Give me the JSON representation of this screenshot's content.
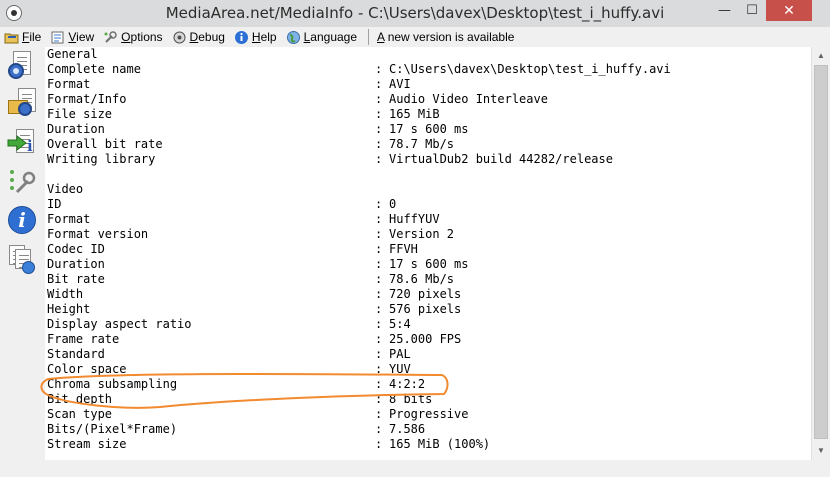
{
  "window": {
    "title": "MediaArea.net/MediaInfo - C:\\Users\\davex\\Desktop\\test_i_huffy.avi",
    "minimize_glyph": "—",
    "maximize_glyph": "☐",
    "close_glyph": "✕"
  },
  "menu": {
    "file": {
      "key": "F",
      "rest": "ile",
      "icon": "folder-icon"
    },
    "view": {
      "key": "V",
      "rest": "iew",
      "icon": "view-icon"
    },
    "options": {
      "key": "O",
      "rest": "ptions",
      "icon": "options-icon"
    },
    "debug": {
      "key": "D",
      "rest": "ebug",
      "icon": "debug-icon"
    },
    "help": {
      "key": "H",
      "rest": "elp",
      "icon": "help-icon"
    },
    "language": {
      "key": "L",
      "rest": "anguage",
      "icon": "globe-icon"
    },
    "update": {
      "key": "A",
      "rest": " new version is available"
    }
  },
  "toolbar": [
    "open-file-icon",
    "open-folder-icon",
    "export-icon",
    "preferences-icon",
    "about-icon",
    "knowledge-base-icon"
  ],
  "info": {
    "general": {
      "heading": "General",
      "complete_name": {
        "name": "Complete name",
        "value": "C:\\Users\\davex\\Desktop\\test_i_huffy.avi"
      },
      "format": {
        "name": "Format",
        "value": "AVI"
      },
      "format_info": {
        "name": "Format/Info",
        "value": "Audio Video Interleave"
      },
      "file_size": {
        "name": "File size",
        "value": "165 MiB"
      },
      "duration": {
        "name": "Duration",
        "value": "17 s 600 ms"
      },
      "overall_bit_rate": {
        "name": "Overall bit rate",
        "value": "78.7 Mb/s"
      },
      "writing_library": {
        "name": "Writing library",
        "value": "VirtualDub2 build 44282/release"
      }
    },
    "video": {
      "heading": "Video",
      "id": {
        "name": "ID",
        "value": "0"
      },
      "format": {
        "name": "Format",
        "value": "HuffYUV"
      },
      "format_version": {
        "name": "Format version",
        "value": "Version 2"
      },
      "codec_id": {
        "name": "Codec ID",
        "value": "FFVH"
      },
      "duration": {
        "name": "Duration",
        "value": "17 s 600 ms"
      },
      "bit_rate": {
        "name": "Bit rate",
        "value": "78.6 Mb/s"
      },
      "width": {
        "name": "Width",
        "value": "720 pixels"
      },
      "height": {
        "name": "Height",
        "value": "576 pixels"
      },
      "display_aspect_ratio": {
        "name": "Display aspect ratio",
        "value": "5:4"
      },
      "frame_rate": {
        "name": "Frame rate",
        "value": "25.000 FPS"
      },
      "standard": {
        "name": "Standard",
        "value": "PAL"
      },
      "color_space": {
        "name": "Color space",
        "value": "YUV"
      },
      "chroma_subsampling": {
        "name": "Chroma subsampling",
        "value": "4:2:2"
      },
      "bit_depth": {
        "name": "Bit depth",
        "value": "8 bits"
      },
      "scan_type": {
        "name": "Scan type",
        "value": "Progressive"
      },
      "bits_pixel_frame": {
        "name": "Bits/(Pixel*Frame)",
        "value": "7.586"
      },
      "stream_size": {
        "name": "Stream size",
        "value": "165 MiB (100%)"
      }
    },
    "separator": ":"
  },
  "annotation": {
    "color": "#f28a30"
  },
  "colors": {
    "title_bar": "#dadbdc",
    "close_button": "#c7504a",
    "chrome": "#f0f0f0"
  }
}
